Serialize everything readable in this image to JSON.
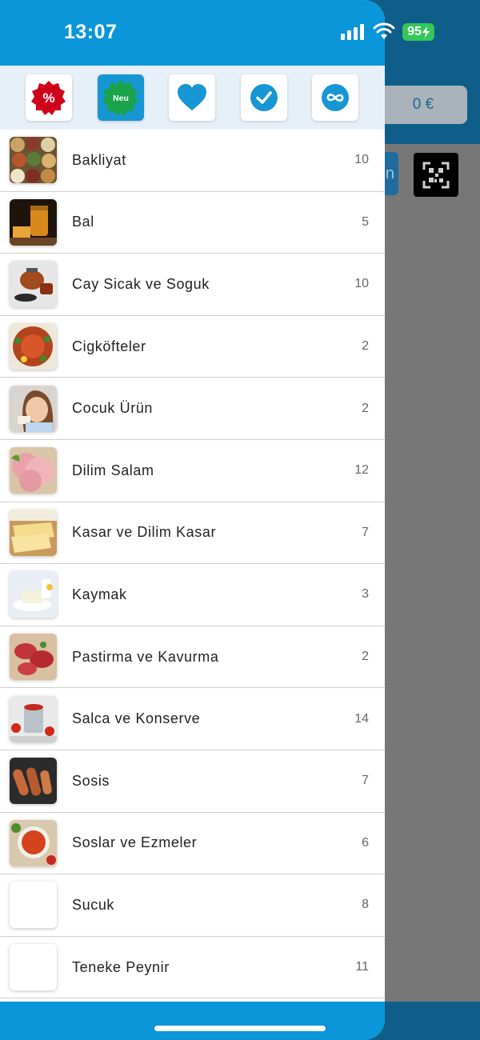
{
  "status_bar": {
    "time": "13:07",
    "battery": "95"
  },
  "background": {
    "total": "0 €",
    "button_fragment": "n"
  },
  "filter_bar": {
    "items": [
      {
        "name": "discount",
        "icon": "percent-badge-icon",
        "label": "%",
        "color": "#d0021b"
      },
      {
        "name": "new",
        "icon": "new-badge-icon",
        "label": "Neu",
        "color": "#1aa34a"
      },
      {
        "name": "favorites",
        "icon": "heart-icon",
        "label": "",
        "color": "#1796d4"
      },
      {
        "name": "checked",
        "icon": "check-circle-icon",
        "label": "",
        "color": "#1796d4"
      },
      {
        "name": "all",
        "icon": "infinity-icon",
        "label": "",
        "color": "#1796d4"
      }
    ]
  },
  "categories": [
    {
      "label": "Bakliyat",
      "count": "10"
    },
    {
      "label": "Bal",
      "count": "5"
    },
    {
      "label": "Cay Sicak ve Soguk",
      "count": "10"
    },
    {
      "label": "Cigköfteler",
      "count": "2"
    },
    {
      "label": "Cocuk Ürün",
      "count": "2"
    },
    {
      "label": "Dilim Salam",
      "count": "12"
    },
    {
      "label": "Kasar ve Dilim Kasar",
      "count": "7"
    },
    {
      "label": "Kaymak",
      "count": "3"
    },
    {
      "label": "Pastirma ve Kavurma",
      "count": "2"
    },
    {
      "label": "Salca ve Konserve",
      "count": "14"
    },
    {
      "label": "Sosis",
      "count": "7"
    },
    {
      "label": "Soslar ve Ezmeler",
      "count": "6"
    },
    {
      "label": "Sucuk",
      "count": "8"
    },
    {
      "label": "Teneke Peynir",
      "count": "11"
    }
  ],
  "colors": {
    "primary": "#0a96d8",
    "background_header": "#0e5e89",
    "overlay": "#777777"
  }
}
